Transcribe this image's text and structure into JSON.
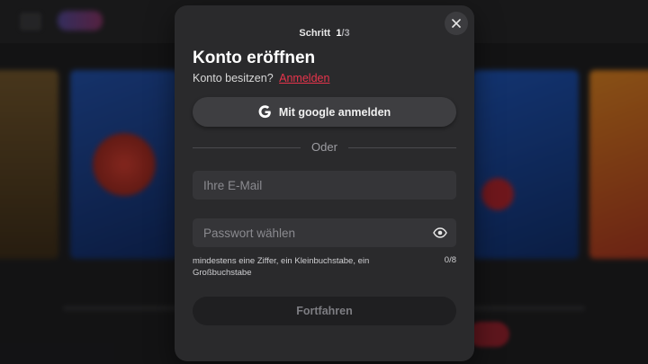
{
  "modal": {
    "step_label": "Schritt",
    "step_current": "1",
    "step_total": "/3",
    "title": "Konto eröffnen",
    "has_account_text": "Konto besitzen?",
    "login_link": "Anmelden",
    "google_button": "Mit google anmelden",
    "divider_text": "Oder",
    "email_placeholder": "Ihre E-Mail",
    "password_placeholder": "Passwort wählen",
    "password_hint": "mindestens eine Ziffer, ein Kleinbuchstabe, ein Großbuchstabe",
    "password_counter": "0/8",
    "continue_button": "Fortfahren"
  },
  "colors": {
    "accent_link": "#e8344c",
    "modal_bg": "#2a2a2c"
  },
  "icons": {
    "close": "close-icon",
    "google": "google-icon",
    "eye": "eye-icon"
  }
}
